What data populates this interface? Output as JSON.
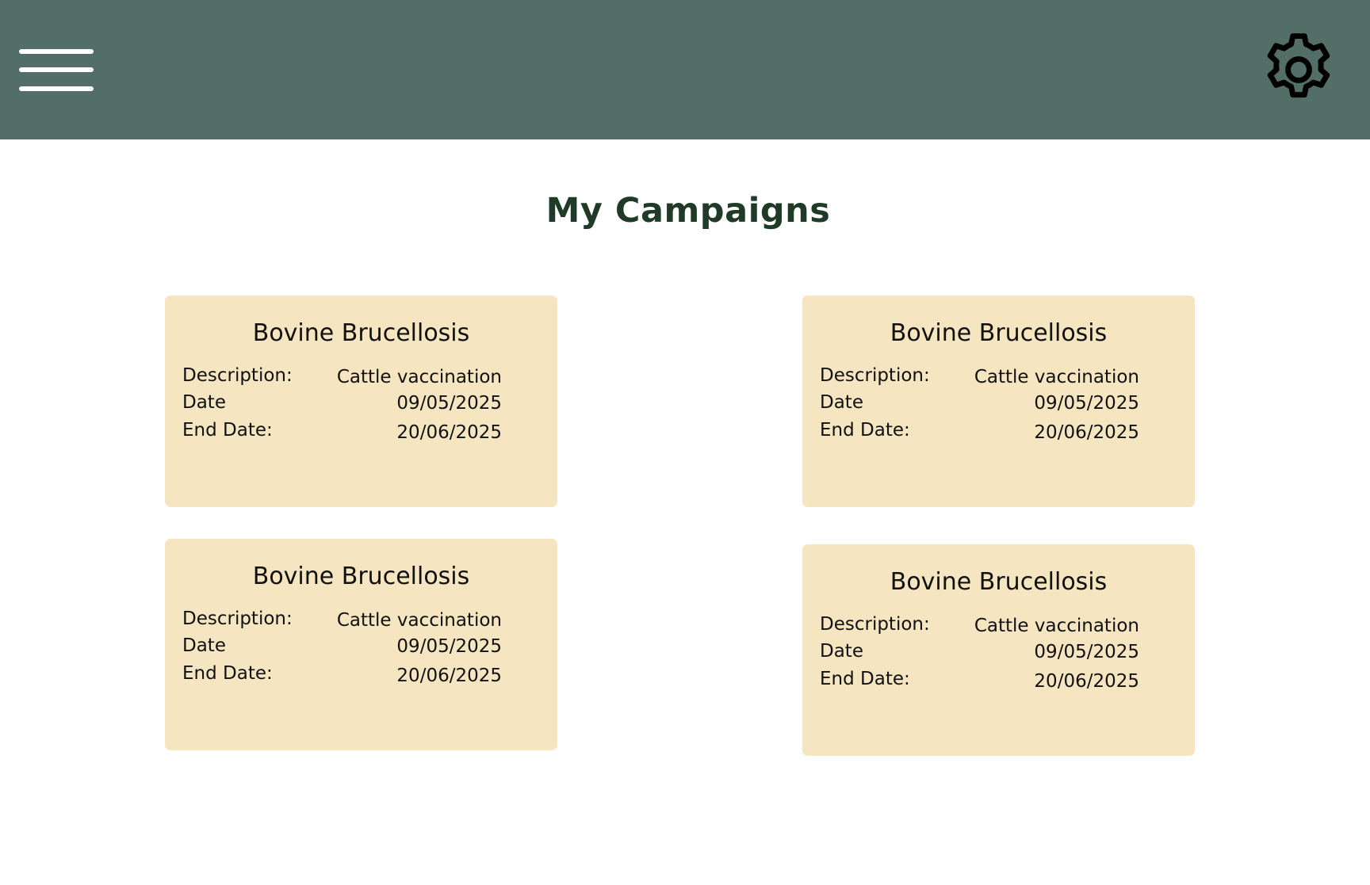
{
  "header": {
    "menu_icon": "hamburger-menu-icon",
    "settings_icon": "gear-icon",
    "background_color": "#526e67"
  },
  "page": {
    "title": "My Campaigns",
    "title_color": "#1f3a26"
  },
  "cards_style": {
    "background_color": "#f5e5c0"
  },
  "campaigns": [
    {
      "title": "Bovine Brucellosis",
      "description_label": "Description:",
      "description": "Cattle vaccination",
      "date_label": "Date",
      "date": "09/05/2025",
      "end_date_label": "End Date:",
      "end_date": "20/06/2025"
    },
    {
      "title": "Bovine Brucellosis",
      "description_label": "Description:",
      "description": "Cattle vaccination",
      "date_label": "Date",
      "date": "09/05/2025",
      "end_date_label": "End Date:",
      "end_date": "20/06/2025"
    },
    {
      "title": "Bovine Brucellosis",
      "description_label": "Description:",
      "description": "Cattle vaccination",
      "date_label": "Date",
      "date": "09/05/2025",
      "end_date_label": "End Date:",
      "end_date": "20/06/2025"
    },
    {
      "title": "Bovine Brucellosis",
      "description_label": "Description:",
      "description": "Cattle vaccination",
      "date_label": "Date",
      "date": "09/05/2025",
      "end_date_label": "End Date:",
      "end_date": "20/06/2025"
    }
  ]
}
